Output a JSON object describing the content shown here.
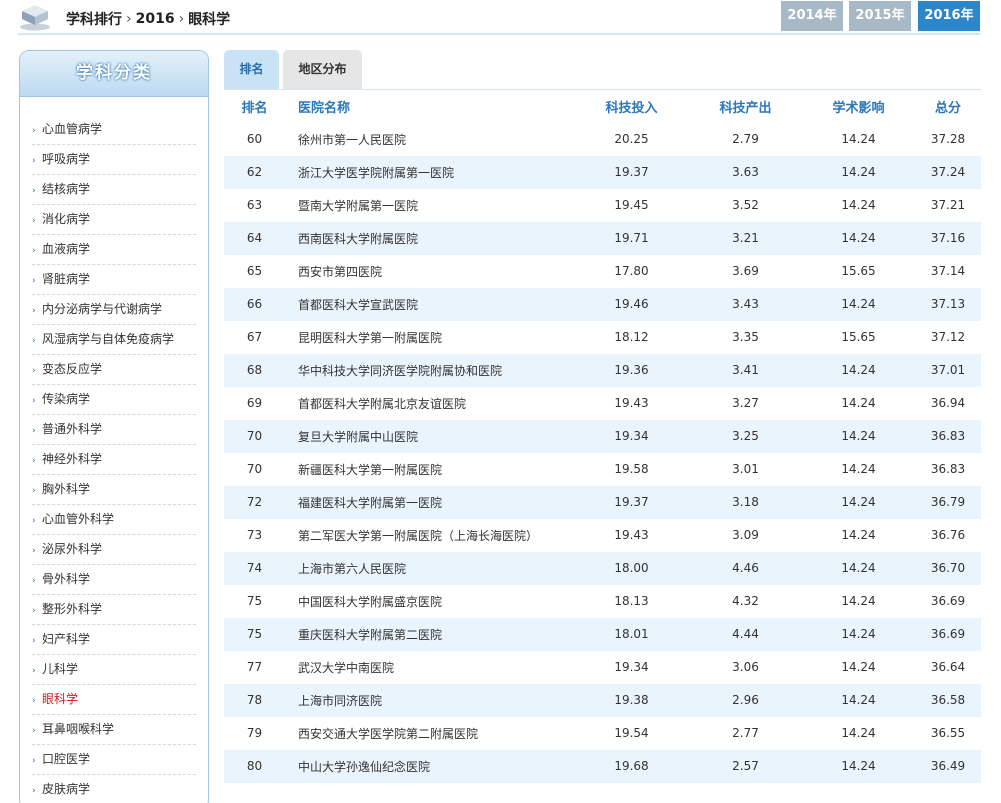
{
  "header": {
    "logo_icon": "books-stack-icon",
    "breadcrumb": [
      "学科排行",
      "2016",
      "眼科学"
    ],
    "years": [
      {
        "label": "2014年",
        "active": false
      },
      {
        "label": "2015年",
        "active": false
      },
      {
        "label": "2016年",
        "active": true
      }
    ]
  },
  "sidebar": {
    "title": "学科分类",
    "items": [
      {
        "label": "心血管病学",
        "active": false
      },
      {
        "label": "呼吸病学",
        "active": false
      },
      {
        "label": "结核病学",
        "active": false
      },
      {
        "label": "消化病学",
        "active": false
      },
      {
        "label": "血液病学",
        "active": false
      },
      {
        "label": "肾脏病学",
        "active": false
      },
      {
        "label": "内分泌病学与代谢病学",
        "active": false
      },
      {
        "label": "风湿病学与自体免疫病学",
        "active": false
      },
      {
        "label": "变态反应学",
        "active": false
      },
      {
        "label": "传染病学",
        "active": false
      },
      {
        "label": "普通外科学",
        "active": false
      },
      {
        "label": "神经外科学",
        "active": false
      },
      {
        "label": "胸外科学",
        "active": false
      },
      {
        "label": "心血管外科学",
        "active": false
      },
      {
        "label": "泌尿外科学",
        "active": false
      },
      {
        "label": "骨外科学",
        "active": false
      },
      {
        "label": "整形外科学",
        "active": false
      },
      {
        "label": "妇产科学",
        "active": false
      },
      {
        "label": "儿科学",
        "active": false
      },
      {
        "label": "眼科学",
        "active": true
      },
      {
        "label": "耳鼻咽喉科学",
        "active": false
      },
      {
        "label": "口腔医学",
        "active": false
      },
      {
        "label": "皮肤病学",
        "active": false
      }
    ]
  },
  "tabs": [
    {
      "label": "排名",
      "active": true
    },
    {
      "label": "地区分布",
      "active": false
    }
  ],
  "table": {
    "headers": [
      "排名",
      "医院名称",
      "科技投入",
      "科技产出",
      "学术影响",
      "总分"
    ],
    "rows": [
      [
        "60",
        "徐州市第一人民医院",
        "20.25",
        "2.79",
        "14.24",
        "37.28"
      ],
      [
        "62",
        "浙江大学医学院附属第一医院",
        "19.37",
        "3.63",
        "14.24",
        "37.24"
      ],
      [
        "63",
        "暨南大学附属第一医院",
        "19.45",
        "3.52",
        "14.24",
        "37.21"
      ],
      [
        "64",
        "西南医科大学附属医院",
        "19.71",
        "3.21",
        "14.24",
        "37.16"
      ],
      [
        "65",
        "西安市第四医院",
        "17.80",
        "3.69",
        "15.65",
        "37.14"
      ],
      [
        "66",
        "首都医科大学宣武医院",
        "19.46",
        "3.43",
        "14.24",
        "37.13"
      ],
      [
        "67",
        "昆明医科大学第一附属医院",
        "18.12",
        "3.35",
        "15.65",
        "37.12"
      ],
      [
        "68",
        "华中科技大学同济医学院附属协和医院",
        "19.36",
        "3.41",
        "14.24",
        "37.01"
      ],
      [
        "69",
        "首都医科大学附属北京友谊医院",
        "19.43",
        "3.27",
        "14.24",
        "36.94"
      ],
      [
        "70",
        "复旦大学附属中山医院",
        "19.34",
        "3.25",
        "14.24",
        "36.83"
      ],
      [
        "70",
        "新疆医科大学第一附属医院",
        "19.58",
        "3.01",
        "14.24",
        "36.83"
      ],
      [
        "72",
        "福建医科大学附属第一医院",
        "19.37",
        "3.18",
        "14.24",
        "36.79"
      ],
      [
        "73",
        "第二军医大学第一附属医院（上海长海医院）",
        "19.43",
        "3.09",
        "14.24",
        "36.76"
      ],
      [
        "74",
        "上海市第六人民医院",
        "18.00",
        "4.46",
        "14.24",
        "36.70"
      ],
      [
        "75",
        "中国医科大学附属盛京医院",
        "18.13",
        "4.32",
        "14.24",
        "36.69"
      ],
      [
        "75",
        "重庆医科大学附属第二医院",
        "18.01",
        "4.44",
        "14.24",
        "36.69"
      ],
      [
        "77",
        "武汉大学中南医院",
        "19.34",
        "3.06",
        "14.24",
        "36.64"
      ],
      [
        "78",
        "上海市同济医院",
        "19.38",
        "2.96",
        "14.24",
        "36.58"
      ],
      [
        "79",
        "西安交通大学医学院第二附属医院",
        "19.54",
        "2.77",
        "14.24",
        "36.55"
      ],
      [
        "80",
        "中山大学孙逸仙纪念医院",
        "19.68",
        "2.57",
        "14.24",
        "36.49"
      ]
    ]
  },
  "colors": {
    "accent": "#2b86cb",
    "header_text": "#2a77bd",
    "active_category": "#d01a1a",
    "row_stripe": "#e9f4fc"
  }
}
